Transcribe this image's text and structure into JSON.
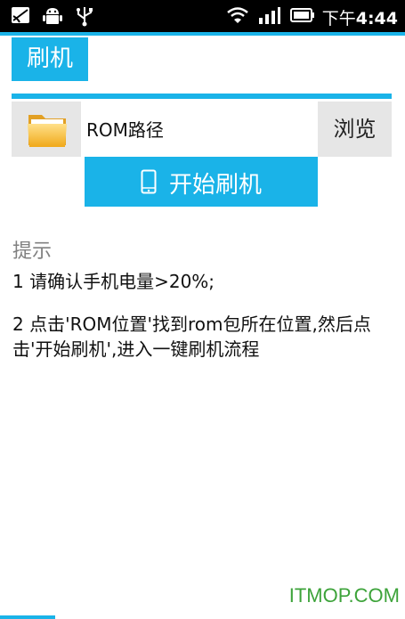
{
  "status_bar": {
    "icons": [
      "notification-icon",
      "android-debug-icon",
      "usb-icon",
      "wifi-icon",
      "signal-icon",
      "battery-icon"
    ],
    "time_prefix": "下午",
    "time": "4:44"
  },
  "tab": {
    "label": "刷机"
  },
  "rom": {
    "folder_icon": "folder-icon",
    "path_label": "ROM路径",
    "browse_label": "浏览"
  },
  "flash_button": {
    "icon": "phone-icon",
    "label": "开始刷机"
  },
  "hint": {
    "title": "提示",
    "line1": "1 请确认手机电量>20%;",
    "line2": "2 点击'ROM位置'找到rom包所在位置,然后点击'开始刷机',进入一键刷机流程"
  },
  "watermark": "ITMOP.COM",
  "colors": {
    "accent": "#1ab3e8",
    "button_gray": "#e6e6e6",
    "watermark": "#3da33a"
  }
}
